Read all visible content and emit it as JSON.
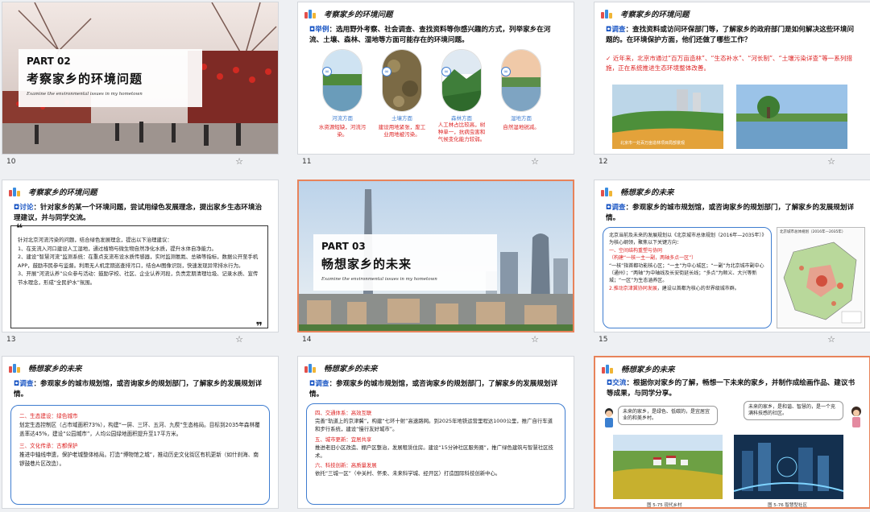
{
  "slides": [
    {
      "num": "10",
      "part": "PART 02",
      "title": "考察家乡的环境问题",
      "subtitle": "Examine the environmental issues in my hometown"
    },
    {
      "num": "11",
      "header": "考察家乡的环境问题",
      "tag": "举例",
      "question": "：选用野外考察、社会调查、查找资料等你感兴趣的方式，列举家乡在河流、土壤、森林、湿地等方面可能存在的环境问题。",
      "items": [
        {
          "cat": "河流方面",
          "desc": "水资源短缺，河流污染。"
        },
        {
          "cat": "土壤方面",
          "desc": "建设用地紧张，废工业用地被污染。"
        },
        {
          "cat": "森林方面",
          "desc": "人工林占比较高，树种单一，抗病虫害和气候变化能力较弱。"
        },
        {
          "cat": "湿地方面",
          "desc": "自然湿地锐减。"
        }
      ]
    },
    {
      "num": "12",
      "header": "考察家乡的环境问题",
      "tag": "调查",
      "question": "：查找资料或访问环保部门等，了解家乡的政府部门是如何解决这些环境问题的。在环境保护方面，他们还做了哪些工作？",
      "answer": "近年来，北京市通过“百万亩造林”、“生态补水”、“河长制”、“土壤污染详查”等一系列措施，正在系统推进生态环境整体改善。",
      "photo_caption": "北京市一处百万亩造林项目局部景观"
    },
    {
      "num": "13",
      "header": "考察家乡的环境问题",
      "tag": "讨论",
      "question": "：针对家乡的某一个环境问题，尝试用绿色发展理念，提出家乡生态环境治理建议，并与同学交流。",
      "intro": "针对北京河流污染的问题，结合绿色发展理念，提出以下治理建议：",
      "points": [
        "1、在支流入河口建设人工湿地，通过植物与微生物自然净化水质，提升水体自净能力。",
        "2、建设“智慧河流”监测系统：在重点支流布设水质传感器，实时监测氨氮、总磷等指标，数据公开至手机APP，鼓励市民参与监督。利用无人机定期巡查排污口，结合AI图像识别，快速发现异常排水行为。",
        "3、开展“河流认养”公众参与活动：鼓励学校、社区、企业认养河段，负责定期清理垃圾、记录水质、宣传节水理念，形成“全民护水”氛围。"
      ]
    },
    {
      "num": "14",
      "part": "PART 03",
      "title": "畅想家乡的未来",
      "subtitle": "Examine the environmental issues in my hometown"
    },
    {
      "num": "15",
      "header": "畅想家乡的未来",
      "tag": "调查",
      "question": "：参观家乡的城市规划馆，或咨询家乡的规划部门，了解家乡的发展规划详情。",
      "body": "北京当前及未来的发展规划以《北京城市总体规划（2016年—2035年）》为核心纲领，聚焦以下关键方向：",
      "h1": "一、空间结构重塑与协同",
      "h1b": "（构建“一核一主一副，两轴多点一区”）",
      "p1": "“一核”指首都功能核心区；“一主”为中心城区；“一副”为北京城市副中心（通州）；“两轴”为中轴线及长安街延长线；“多点”为顺义、大兴等新城；“一区”为生态涵养区。",
      "h2": "2.推动京津冀协同发展",
      "p2": "，建设以首都为核心的世界级城市群。",
      "map_title": "北京城市总体规划（2016年—2035年）"
    },
    {
      "num": "16",
      "header": "畅想家乡的未来",
      "tag": "调查",
      "question": "：参观家乡的城市规划馆，或咨询家乡的规划部门，了解家乡的发展规划详情。",
      "sections": [
        {
          "h": "二、生态建设：绿色城市",
          "t": "划定生态控制区（占市域面积73%），构建“一屏、三环、五河、九楔”生态格局。目标到2035年森林覆盖率达45%，建设“公园城市”，人均公园绿地面积提升至17平方米。"
        },
        {
          "h": "三、文化传承：古都保护",
          "t": "推进中轴线申遗，保护老城整体格局。打造“博物馆之城”，推动历史文化街区有机更新（如什刹海、南锣鼓巷片区改造）。"
        }
      ]
    },
    {
      "num": "17",
      "header": "畅想家乡的未来",
      "tag": "调查",
      "question": "：参观家乡的城市规划馆，或咨询家乡的规划部门，了解家乡的发展规划详情。",
      "sections": [
        {
          "h": "四、交通体系：高效互联",
          "t": "完善“轨道上的京津冀”，构建“七环十射”高速路网。到2025年地铁运营里程达1000公里，推广自行车道和步行系统，建设“慢行友好城市”。"
        },
        {
          "h": "五、城市更新：宜居共享",
          "t": "推进老旧小区改造、棚户区整治，发展租赁住房。建设“15分钟社区服务圈”，推广绿色建筑与智慧社区技术。"
        },
        {
          "h": "六、科技创新：高质量发展",
          "t": "依托“三城一区”（中关村、怀柔、未来科学城、经开区）打造国际科技创新中心。"
        }
      ]
    },
    {
      "num": "18",
      "header": "畅想家乡的未来",
      "tag": "交流",
      "question": "：根据你对家乡的了解，畅想一下未来的家乡，并制作成绘画作品、建议书等成果，与同学分享。",
      "bubble1": "未来的家乡，是绿色、低碳的，是宜居宜业的和美乡村。",
      "bubble2": "未来的家乡，是和谐、智慧的，是一个充满科技感的社区。",
      "cap1": "图 5-75 现代乡村",
      "cap2": "图 5-76 智慧型社区"
    }
  ],
  "colors": {
    "accent": "#1a56c4",
    "red": "#d22222",
    "selected": "#e8835a"
  }
}
